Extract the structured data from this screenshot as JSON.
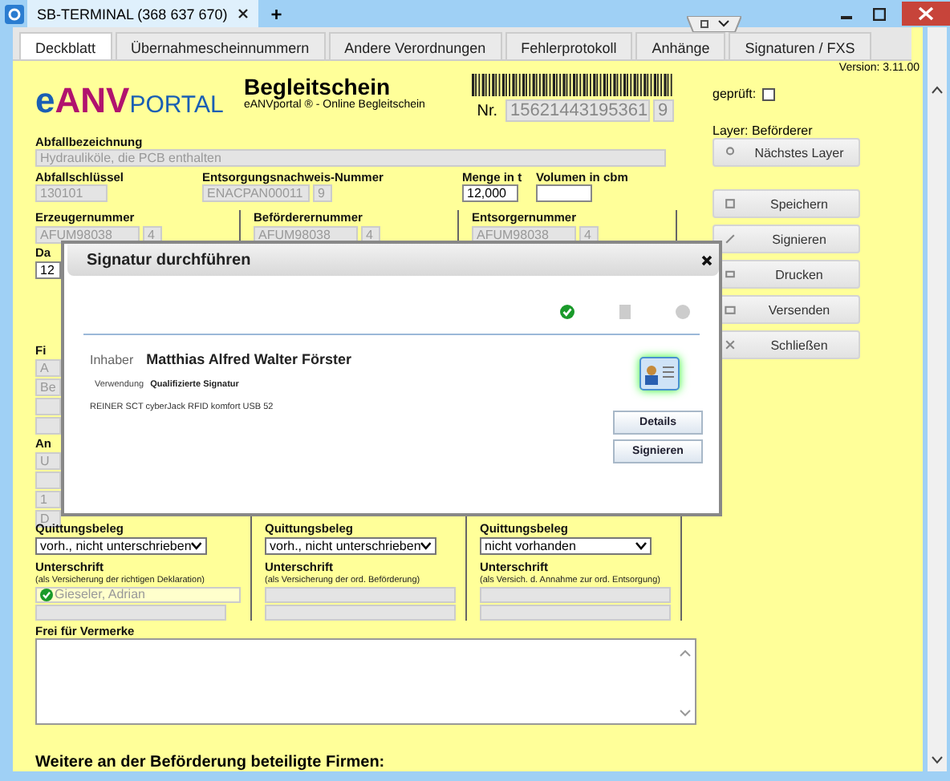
{
  "window": {
    "title": "SB-TERMINAL (368 637 670)",
    "new_tab": "+"
  },
  "tabs": [
    {
      "label": "Deckblatt",
      "selected": true
    },
    {
      "label": "Übernahmescheinnummern",
      "selected": false
    },
    {
      "label": "Andere Verordnungen",
      "selected": false
    },
    {
      "label": "Fehlerprotokoll",
      "selected": false
    },
    {
      "label": "Anhänge",
      "selected": false
    },
    {
      "label": "Signaturen / FXS",
      "selected": false
    }
  ],
  "header": {
    "logo_e": "e",
    "logo_anv": "ANV",
    "logo_portal": "PORTAL",
    "title": "Begleitschein",
    "subtitle": "eANVportal ® - Online Begleitschein",
    "nr_label": "Nr.",
    "nr": "15621443195361",
    "nr_check": "9"
  },
  "waste": {
    "label": "Abfallbezeichnung",
    "value": "Hydrauliköle, die PCB enthalten"
  },
  "row2": {
    "key_label": "Abfallschlüssel",
    "key": "130101",
    "proof_label": "Entsorgungsnachweis-Nummer",
    "proof": "ENACPAN00011",
    "proof_check": "9",
    "amount_label": "Menge in t",
    "amount": "12,000",
    "volume_label": "Volumen in cbm"
  },
  "parties": [
    {
      "label": "Erzeugernummer",
      "number": "AFUM98038",
      "check": "4"
    },
    {
      "label": "Beförderernummer",
      "number": "AFUM98038",
      "check": "4"
    },
    {
      "label": "Entsorgernummer",
      "number": "AFUM98038",
      "check": "4"
    }
  ],
  "covered": {
    "date_label": "Da",
    "date": "12",
    "firm_label": "Fi",
    "firm_lines": [
      "A",
      "Be"
    ],
    "address_label": "An",
    "address_lines": [
      "U",
      "1",
      "D"
    ]
  },
  "receipts": [
    {
      "label": "Quittungsbeleg",
      "value": "vorh., nicht unterschrieben",
      "sign_label": "Unterschrift",
      "sign_note": "(als Versicherung der richtigen Deklaration)",
      "signer": "Gieseler, Adrian",
      "signed": true
    },
    {
      "label": "Quittungsbeleg",
      "value": "vorh., nicht unterschrieben",
      "sign_label": "Unterschrift",
      "sign_note": "(als Versicherung der ord. Beförderung)",
      "signed": false
    },
    {
      "label": "Quittungsbeleg",
      "value": "nicht vorhanden",
      "sign_label": "Unterschrift",
      "sign_note": "(als Versich. d. Annahme zur ord. Entsorgung)",
      "signed": false
    }
  ],
  "notes": {
    "label": "Frei für Vermerke"
  },
  "more_firms": "Weitere an der Beförderung beteiligte Firmen:",
  "sidebar": {
    "version": "Version: 3.11.00",
    "checked_label": "geprüft:",
    "checked": false,
    "layer": "Layer: Beförderer",
    "buttons": [
      {
        "kind": "person",
        "label": "Nächstes Layer"
      },
      {
        "kind": "save",
        "label": "Speichern"
      },
      {
        "kind": "pen",
        "label": "Signieren"
      },
      {
        "kind": "print",
        "label": "Drucken"
      },
      {
        "kind": "mail",
        "label": "Versenden"
      },
      {
        "kind": "close",
        "label": "Schließen"
      }
    ]
  },
  "dialog": {
    "title": "Signatur durchführen",
    "steps": [
      {
        "kind": "done"
      },
      {
        "kind": "document"
      },
      {
        "kind": "idle"
      }
    ],
    "owner_label": "Inhaber",
    "owner": "Matthias Alfred Walter Förster",
    "usage_label": "Verwendung",
    "usage": "Qualifizierte Signatur",
    "reader": "REINER SCT cyberJack RFID komfort USB 52",
    "buttons": [
      "Details",
      "Signieren"
    ]
  }
}
